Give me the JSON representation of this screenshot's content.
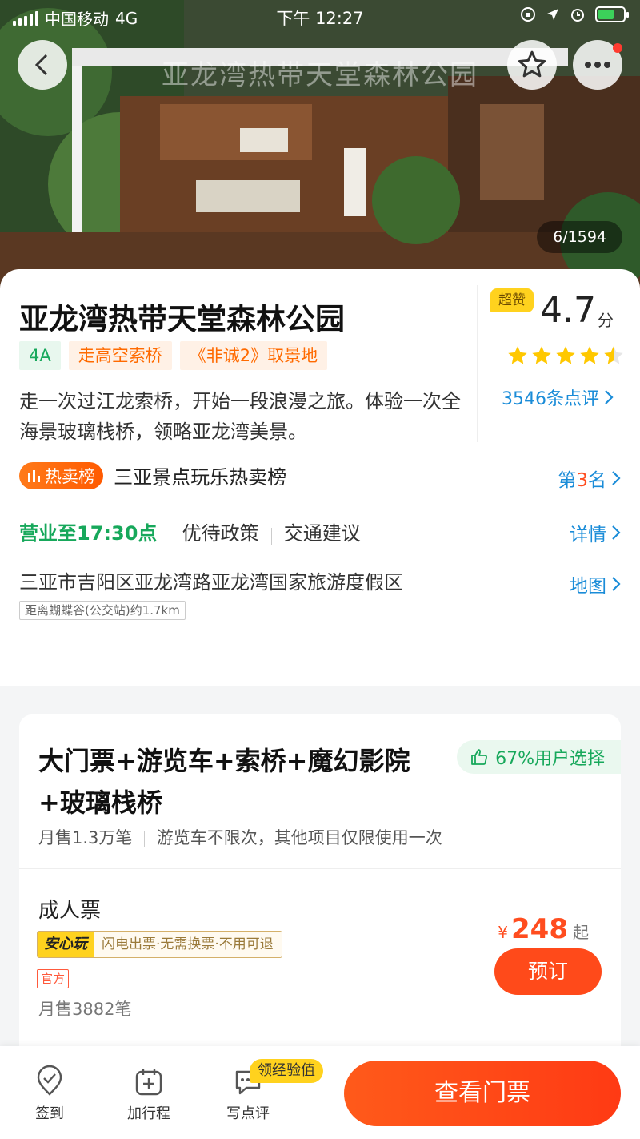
{
  "status_bar": {
    "carrier": "中国移动",
    "network": "4G",
    "time": "下午 12:27"
  },
  "hero": {
    "title": "亚龙湾热带天堂森林公园",
    "photo_counter": "6/1594"
  },
  "attraction": {
    "name": "亚龙湾热带天堂森林公园",
    "tags": [
      "4A",
      "走高空索桥",
      "《非诚2》取景地"
    ],
    "description": "走一次过江龙索桥，开始一段浪漫之旅。体验一次全海景玻璃栈桥，领略亚龙湾美景。",
    "rating": {
      "badge": "超赞",
      "score": "4.7",
      "unit": "分",
      "stars": 4.5,
      "reviews": "3546条点评"
    },
    "ranking": {
      "badge": "热卖榜",
      "text": "三亚景点玩乐热卖榜",
      "rank_prefix": "第",
      "rank_num": "3",
      "rank_suffix": "名"
    },
    "hours": {
      "open": "营业至17:30点",
      "policy": "优待政策",
      "traffic": "交通建议",
      "link": "详情"
    },
    "address": {
      "text": "三亚市吉阳区亚龙湾路亚龙湾国家旅游度假区",
      "distance": "距离蝴蝶谷(公交站)约1.7km",
      "link": "地图"
    }
  },
  "ticket": {
    "package_title": "大门票+游览车+索桥+魔幻影院+玻璃栈桥",
    "choice": "67%用户选择",
    "monthly_sales": "月售1.3万笔",
    "note": "游览车不限次，其他项目仅限使用一次",
    "item": {
      "name": "成人票",
      "anxin_label": "安心玩",
      "anxin_desc": "闪电出票·无需换票·不用可退",
      "official": "官方",
      "sold": "月售3882笔",
      "currency": "¥",
      "price": "248",
      "price_suffix": "起",
      "book": "预订"
    }
  },
  "bottom_bar": {
    "checkin": "签到",
    "add_trip": "加行程",
    "review": "写点评",
    "reward": "领经验值",
    "cta": "查看门票"
  },
  "colors": {
    "accent_orange": "#ff4a1a",
    "link_blue": "#1a8cd8",
    "green": "#17a85b",
    "star_yellow": "#ffc800"
  }
}
